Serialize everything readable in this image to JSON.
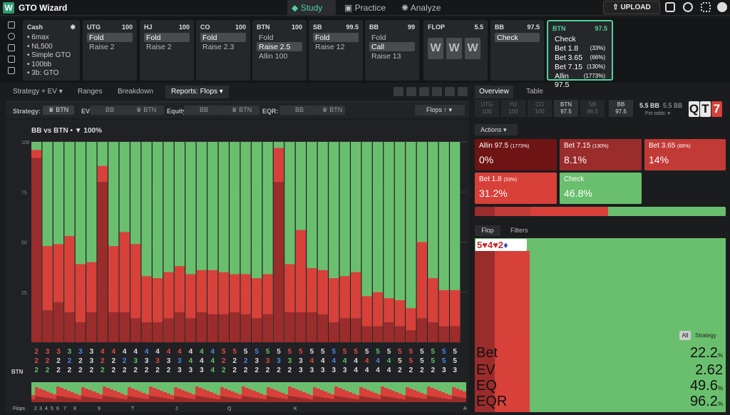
{
  "app": {
    "title": "GTO Wizard",
    "logo": "W"
  },
  "nav": {
    "study": "Study",
    "practice": "Practice",
    "analyze": "Analyze",
    "upload": "UPLOAD"
  },
  "cash": {
    "title": "Cash",
    "lines": [
      "• 6max",
      "• NL500",
      "• Simple GTO",
      "• 100bb",
      "• 3b: GTO"
    ]
  },
  "positions": [
    {
      "pos": "UTG",
      "stack": "100",
      "items": [
        "Fold",
        "Raise 2"
      ],
      "sel": 0
    },
    {
      "pos": "HJ",
      "stack": "100",
      "items": [
        "Fold",
        "Raise 2"
      ],
      "sel": 0
    },
    {
      "pos": "CO",
      "stack": "100",
      "items": [
        "Fold",
        "Raise 2.3"
      ],
      "sel": 0
    },
    {
      "pos": "BTN",
      "stack": "100",
      "items": [
        "Fold",
        "Raise 2.5",
        "Allin 100"
      ],
      "sel": 1
    },
    {
      "pos": "SB",
      "stack": "99.5",
      "items": [
        "Fold",
        "Raise 12"
      ],
      "sel": 0
    },
    {
      "pos": "BB",
      "stack": "99",
      "items": [
        "Fold",
        "Call",
        "Raise 13"
      ],
      "sel": 1
    }
  ],
  "flop": {
    "title": "FLOP",
    "pot": "5.5",
    "cards": [
      "W",
      "W",
      "W"
    ]
  },
  "bb_box": {
    "pos": "BB",
    "stack": "97.5",
    "items": [
      "Check"
    ]
  },
  "btn_box": {
    "pos": "BTN",
    "stack": "97.5",
    "items": [
      {
        "label": "Check",
        "pct": ""
      },
      {
        "label": "Bet 1.8",
        "pct": "(33%)"
      },
      {
        "label": "Bet 3.65",
        "pct": "(66%)"
      },
      {
        "label": "Bet 7.15",
        "pct": "(130%)"
      },
      {
        "label": "Allin 97.5",
        "pct": "(1773%)"
      }
    ]
  },
  "subtabs": {
    "strategy": "Strategy + EV ▾",
    "ranges": "Ranges",
    "breakdown": "Breakdown",
    "reports": "Reports: Flops ▾"
  },
  "filters": {
    "strategy": "Strategy:",
    "ev": "EV:",
    "equity": "Equity:",
    "eqr": "EQR:",
    "bb": "BB",
    "btn": "♛ BTN",
    "sort": "Flops ↑ ▾"
  },
  "chart_title": "BB vs BTN • ▼ 100%",
  "chart_data": {
    "type": "bar",
    "stacked": true,
    "yticks": [
      100,
      75,
      50,
      25
    ],
    "ylim": [
      0,
      100
    ],
    "series_colors": {
      "allin": "#6e1414",
      "bet_large": "#9a2c2c",
      "bet_small": "#d8403a",
      "check": "#6abf6e"
    },
    "bars": [
      {
        "dark": 92,
        "red": 96
      },
      {
        "dark": 16,
        "red": 48
      },
      {
        "dark": 20,
        "red": 49
      },
      {
        "dark": 15,
        "red": 53
      },
      {
        "dark": 10,
        "red": 39
      },
      {
        "dark": 15,
        "red": 40
      },
      {
        "dark": 80,
        "red": 88
      },
      {
        "dark": 15,
        "red": 48
      },
      {
        "dark": 15,
        "red": 55
      },
      {
        "dark": 12,
        "red": 49
      },
      {
        "dark": 10,
        "red": 33
      },
      {
        "dark": 10,
        "red": 32
      },
      {
        "dark": 12,
        "red": 35
      },
      {
        "dark": 15,
        "red": 38
      },
      {
        "dark": 12,
        "red": 34
      },
      {
        "dark": 15,
        "red": 36
      },
      {
        "dark": 14,
        "red": 36
      },
      {
        "dark": 14,
        "red": 35
      },
      {
        "dark": 15,
        "red": 34
      },
      {
        "dark": 14,
        "red": 34
      },
      {
        "dark": 12,
        "red": 32
      },
      {
        "dark": 14,
        "red": 34
      },
      {
        "dark": 80,
        "red": 97
      },
      {
        "dark": 15,
        "red": 39
      },
      {
        "dark": 15,
        "red": 56
      },
      {
        "dark": 15,
        "red": 37
      },
      {
        "dark": 14,
        "red": 36
      },
      {
        "dark": 10,
        "red": 32
      },
      {
        "dark": 12,
        "red": 33
      },
      {
        "dark": 12,
        "red": 35
      },
      {
        "dark": 8,
        "red": 23
      },
      {
        "dark": 8,
        "red": 25
      },
      {
        "dark": 10,
        "red": 22
      },
      {
        "dark": 8,
        "red": 21
      },
      {
        "dark": 6,
        "red": 17
      },
      {
        "dark": 12,
        "red": 50
      },
      {
        "dark": 10,
        "red": 32
      },
      {
        "dark": 8,
        "red": 26
      },
      {
        "dark": 8,
        "red": 26
      }
    ],
    "xlabels_top": [
      "2",
      "3",
      "3",
      "3",
      "3",
      "3",
      "4",
      "4",
      "4",
      "4",
      "4",
      "4",
      "4",
      "4",
      "4",
      "4",
      "4",
      "5",
      "5",
      "5",
      "5",
      "5",
      "5",
      "5",
      "5",
      "5",
      "5",
      "5",
      "5",
      "5",
      "5",
      "5",
      "5",
      "5",
      "5",
      "5",
      "5",
      "5",
      "5"
    ],
    "xlabels_mid": [
      "2",
      "2",
      "2",
      "2",
      "2",
      "3",
      "2",
      "2",
      "2",
      "3",
      "3",
      "3",
      "3",
      "3",
      "4",
      "4",
      "4",
      "2",
      "2",
      "2",
      "3",
      "3",
      "3",
      "3",
      "3",
      "4",
      "4",
      "4",
      "4",
      "4",
      "4",
      "4",
      "4",
      "5",
      "5",
      "5",
      "5",
      "5",
      "5"
    ],
    "xlabels_bot": [
      "2",
      "2",
      "2",
      "2",
      "2",
      "2",
      "2",
      "2",
      "2",
      "2",
      "2",
      "2",
      "2",
      "3",
      "3",
      "3",
      "4",
      "2",
      "2",
      "2",
      "2",
      "2",
      "2",
      "2",
      "3",
      "3",
      "3",
      "3",
      "3",
      "4",
      "4",
      "4",
      "4",
      "2",
      "2",
      "2",
      "2",
      "3",
      "3"
    ],
    "xcolors_top": [
      "r",
      "r",
      "r",
      "g",
      "b",
      "w",
      "r",
      "r",
      "w",
      "w",
      "b",
      "w",
      "r",
      "r",
      "w",
      "g",
      "b",
      "r",
      "r",
      "w",
      "b",
      "g",
      "w",
      "r",
      "r",
      "w",
      "w",
      "b",
      "r",
      "r",
      "w",
      "g",
      "w",
      "r",
      "r",
      "w",
      "g",
      "b",
      "w"
    ],
    "xcolors_mid": [
      "r",
      "r",
      "w",
      "b",
      "w",
      "w",
      "r",
      "w",
      "b",
      "g",
      "w",
      "r",
      "w",
      "b",
      "g",
      "w",
      "g",
      "r",
      "w",
      "b",
      "w",
      "r",
      "b",
      "g",
      "w",
      "r",
      "w",
      "b",
      "g",
      "w",
      "r",
      "b",
      "g",
      "w",
      "r",
      "w",
      "g",
      "b",
      "w"
    ],
    "xcolors_bot": [
      "g",
      "g",
      "w",
      "w",
      "w",
      "w",
      "g",
      "w",
      "w",
      "w",
      "w",
      "w",
      "w",
      "w",
      "w",
      "w",
      "g",
      "g",
      "w",
      "w",
      "w",
      "w",
      "w",
      "w",
      "w",
      "w",
      "w",
      "w",
      "w",
      "w",
      "w",
      "w",
      "w",
      "w",
      "w",
      "w",
      "w",
      "w",
      "w"
    ],
    "xaxis_hero": "BTN",
    "overview_labels": [
      "Flops",
      "2",
      "3",
      "4",
      "5",
      "6",
      "7",
      "8",
      "9",
      "T",
      "J",
      "Q",
      "K",
      "A"
    ]
  },
  "right": {
    "tabs": {
      "overview": "Overview",
      "table": "Table"
    },
    "positions": [
      {
        "p": "UTG",
        "s": "100"
      },
      {
        "p": "HJ",
        "s": "100"
      },
      {
        "p": "CO",
        "s": "100"
      },
      {
        "p": "BTN",
        "s": "97.5"
      },
      {
        "p": "SB",
        "s": "99.5"
      },
      {
        "p": "BB",
        "s": "97.5"
      }
    ],
    "pot": "5.5 BB",
    "pot2": "5.5 BB",
    "pot_odds": "Pot odds: ▾",
    "board": [
      "Q",
      "T",
      "7"
    ],
    "actions_label": "Actions ▾",
    "actions": [
      {
        "name": "Allin 97.5",
        "pct_label": "(1773%)",
        "freq": "0%",
        "color": "#6e1414"
      },
      {
        "name": "Bet 7.15",
        "pct_label": "(130%)",
        "freq": "8.1%",
        "color": "#9a2c2c"
      },
      {
        "name": "Bet 3.65",
        "pct_label": "(66%)",
        "freq": "14%",
        "color": "#c23a36"
      },
      {
        "name": "Bet 1.8",
        "pct_label": "(33%)",
        "freq": "31.2%",
        "color": "#d8403a"
      },
      {
        "name": "Check",
        "pct_label": "",
        "freq": "46.8%",
        "color": "#6abf6e"
      }
    ],
    "freqbar": [
      8.1,
      14,
      31.2,
      46.8
    ],
    "low_tabs": {
      "flop": "Flop",
      "filters": "Filters"
    },
    "flop_label": "5♥4♥2♦",
    "toggle": {
      "all": "All",
      "strategy": "Strategy"
    },
    "stats": [
      {
        "l": "Bet",
        "v": "22.2",
        "u": "%"
      },
      {
        "l": "EV",
        "v": "2.62",
        "u": ""
      },
      {
        "l": "EQ",
        "v": "49.6",
        "u": "%"
      },
      {
        "l": "EQR",
        "v": "96.2",
        "u": "%"
      }
    ]
  }
}
